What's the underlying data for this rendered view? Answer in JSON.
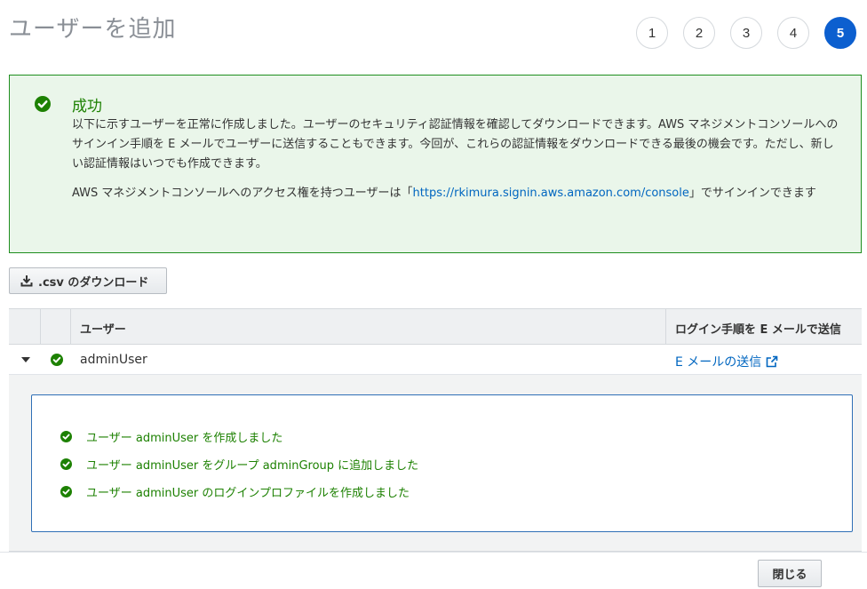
{
  "page": {
    "title": "ユーザーを追加"
  },
  "steps": {
    "items": [
      "1",
      "2",
      "3",
      "4",
      "5"
    ],
    "active": "5"
  },
  "success": {
    "title": "成功",
    "body": "以下に示すユーザーを正常に作成しました。ユーザーのセキュリティ認証情報を確認してダウンロードできます。AWS マネジメントコンソールへのサインイン手順を E メールでユーザーに送信することもできます。今回が、これらの認証情報をダウンロードできる最後の機会です。ただし、新しい認証情報はいつでも作成できます。",
    "signin_prefix": "AWS マネジメントコンソールへのアクセス権を持つユーザーは「",
    "signin_url": "https://rkimura.signin.aws.amazon.com/console",
    "signin_suffix": "」でサインインできます"
  },
  "toolbar": {
    "csv_label": ".csv のダウンロード"
  },
  "table": {
    "columns": {
      "user": "ユーザー",
      "email": "ログイン手順を E メールで送信"
    },
    "rows": [
      {
        "user": "adminUser",
        "email_link": "E メールの送信"
      }
    ],
    "details": [
      "ユーザー adminUser を作成しました",
      "ユーザー adminUser をグループ adminGroup に追加しました",
      "ユーザー adminUser のログインプロファイルを作成しました"
    ]
  },
  "footer": {
    "close_label": "閉じる"
  },
  "colors": {
    "accent": "#0c5fcf",
    "success": "#1d8102",
    "link": "#0066c0"
  }
}
